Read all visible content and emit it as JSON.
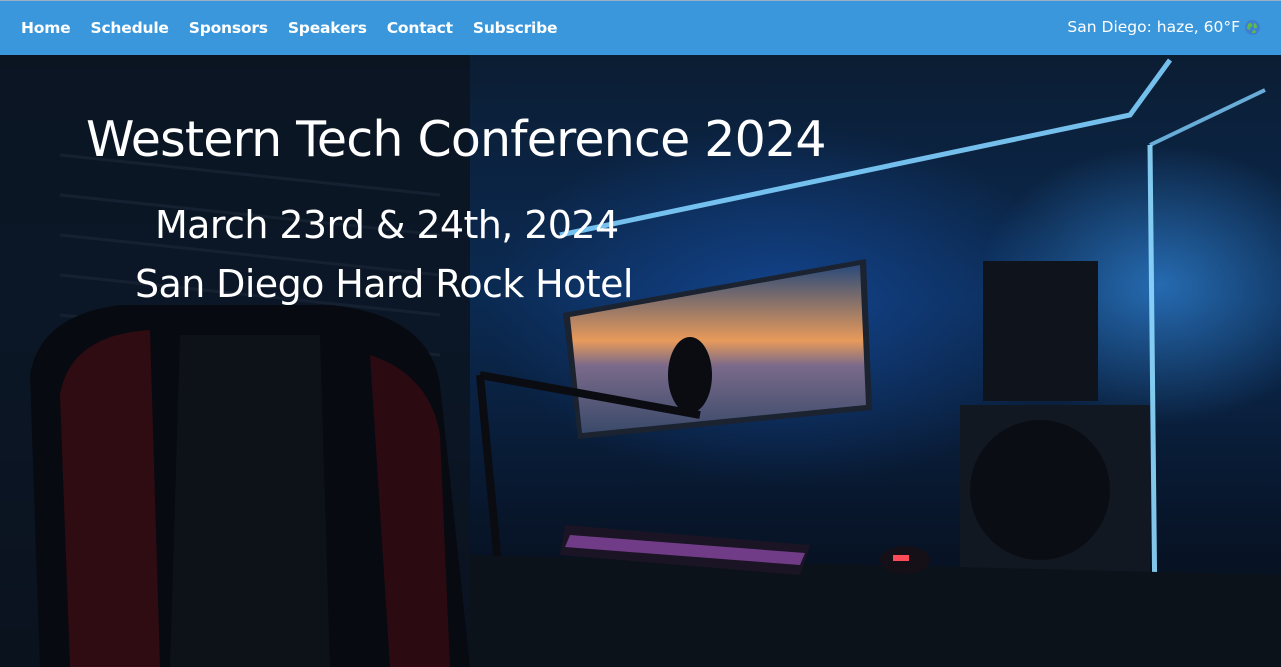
{
  "nav": {
    "items": [
      {
        "label": "Home"
      },
      {
        "label": "Schedule"
      },
      {
        "label": "Sponsors"
      },
      {
        "label": "Speakers"
      },
      {
        "label": "Contact"
      },
      {
        "label": "Subscribe"
      }
    ],
    "weather": {
      "text": "San Diego: haze, 60°F",
      "icon": "globe-icon"
    }
  },
  "hero": {
    "title": "Western Tech Conference 2024",
    "date": "March 23rd & 24th, 2024",
    "venue": "San Diego Hard Rock Hotel",
    "image": "gaming-desk-setup-photo"
  },
  "colors": {
    "navbar": "#3a97dc",
    "text": "#ffffff",
    "led": "#5ab8ff"
  }
}
